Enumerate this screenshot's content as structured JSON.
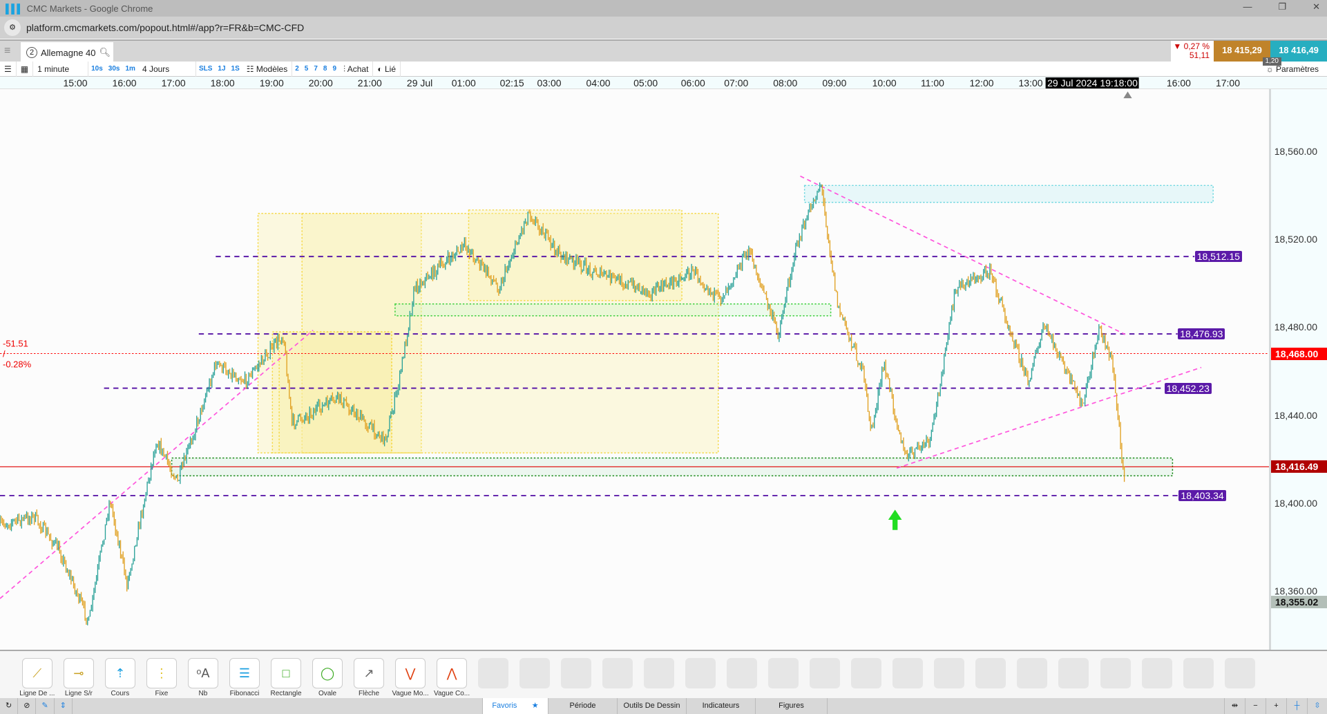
{
  "window": {
    "title": "CMC Markets - Google Chrome",
    "url": "platform.cmcmarkets.com/popout.html#/app?r=FR&b=CMC-CFD"
  },
  "tab": {
    "number": "2",
    "instrument": "Allemagne 40"
  },
  "quote": {
    "change_pct": "0,27 %",
    "change_pts": "51,11",
    "sell": "18 415,29",
    "buy": "18 416,49",
    "spread": "1,20",
    "direction": "down"
  },
  "toolbar": {
    "interval": "1 minute",
    "quick_intervals": [
      "10s",
      "30s",
      "1m"
    ],
    "range": "4 Jours",
    "quick_ranges": [
      "SLS",
      "1J",
      "1S"
    ],
    "models": "Modèles",
    "model_slots": [
      "2",
      "5",
      "7",
      "8",
      "9"
    ],
    "chart_type": "Achat",
    "linked": "Lié",
    "settings": "Paramètres"
  },
  "time_axis": {
    "labels": [
      "15:00",
      "16:00",
      "17:00",
      "18:00",
      "19:00",
      "20:00",
      "21:00",
      "29 Jul",
      "01:00",
      "02:15",
      "03:00",
      "04:00",
      "05:00",
      "06:00",
      "07:00",
      "08:00",
      "09:00",
      "10:00",
      "11:00",
      "12:00",
      "13:00",
      "16:00",
      "17:00"
    ],
    "cursor": "29 Jul 2024 19:18:00"
  },
  "price_axis": {
    "ticks": [
      "18,560.00",
      "18,520.00",
      "18,480.00",
      "18,440.00",
      "18,400.00",
      "18,360.00"
    ],
    "tick_values": [
      18560,
      18520,
      18480,
      18440,
      18400,
      18360
    ]
  },
  "levels": {
    "lines": [
      {
        "value": 18512.15,
        "label": "18,512.15"
      },
      {
        "value": 18476.93,
        "label": "18,476.93"
      },
      {
        "value": 18452.23,
        "label": "18,452.23"
      },
      {
        "value": 18403.34,
        "label": "18,403.34"
      }
    ],
    "prev_close": {
      "value": 18468.0,
      "label": "18,468.00",
      "change_label": "-51.51 / -0.28%"
    },
    "current": {
      "value": 18416.49,
      "label": "18,416.49"
    },
    "low": {
      "value": 18355.02,
      "label": "18,355.02"
    }
  },
  "colors": {
    "level": "#5b1aa8",
    "prev_close": "#ff0000",
    "current": "#b00000",
    "candle_up": "#2aa198",
    "candle_down": "#e0a020",
    "trend": "#ff55dd",
    "sell": "#c0832a",
    "buy": "#27aec0"
  },
  "drawing_tools": [
    "Ligne De ...",
    "Ligne S/r",
    "Cours",
    "Fixe",
    "Nb",
    "Fibonacci",
    "Rectangle",
    "Ovale",
    "Flèche",
    "Vague Mo...",
    "Vague Co..."
  ],
  "bottom_tabs": {
    "favorites": "Favoris",
    "period": "Période",
    "drawing": "Outils De Dessin",
    "indicators": "Indicateurs",
    "figures": "Figures"
  }
}
